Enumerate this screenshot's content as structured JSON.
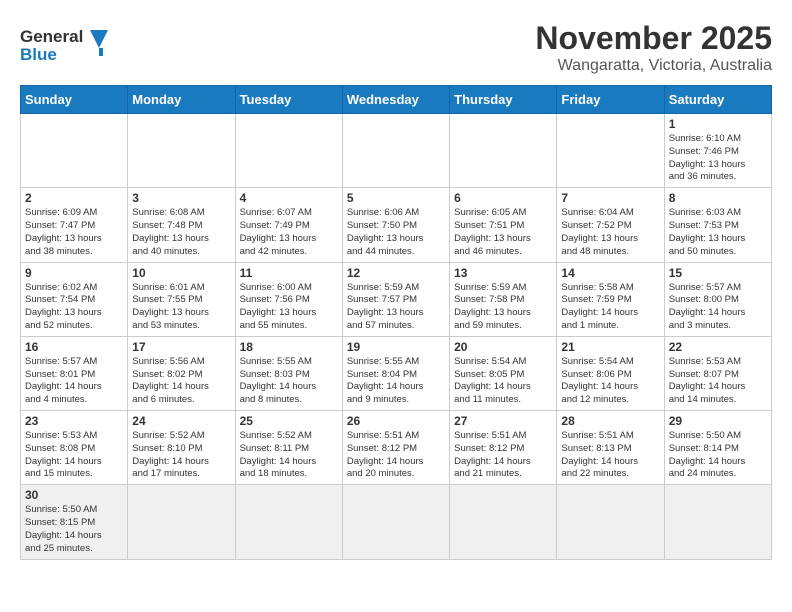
{
  "header": {
    "logo_general": "General",
    "logo_blue": "Blue",
    "month_title": "November 2025",
    "location": "Wangaratta, Victoria, Australia"
  },
  "days_of_week": [
    "Sunday",
    "Monday",
    "Tuesday",
    "Wednesday",
    "Thursday",
    "Friday",
    "Saturday"
  ],
  "weeks": [
    [
      {
        "day": "",
        "info": ""
      },
      {
        "day": "",
        "info": ""
      },
      {
        "day": "",
        "info": ""
      },
      {
        "day": "",
        "info": ""
      },
      {
        "day": "",
        "info": ""
      },
      {
        "day": "",
        "info": ""
      },
      {
        "day": "1",
        "info": "Sunrise: 6:10 AM\nSunset: 7:46 PM\nDaylight: 13 hours\nand 36 minutes."
      }
    ],
    [
      {
        "day": "2",
        "info": "Sunrise: 6:09 AM\nSunset: 7:47 PM\nDaylight: 13 hours\nand 38 minutes."
      },
      {
        "day": "3",
        "info": "Sunrise: 6:08 AM\nSunset: 7:48 PM\nDaylight: 13 hours\nand 40 minutes."
      },
      {
        "day": "4",
        "info": "Sunrise: 6:07 AM\nSunset: 7:49 PM\nDaylight: 13 hours\nand 42 minutes."
      },
      {
        "day": "5",
        "info": "Sunrise: 6:06 AM\nSunset: 7:50 PM\nDaylight: 13 hours\nand 44 minutes."
      },
      {
        "day": "6",
        "info": "Sunrise: 6:05 AM\nSunset: 7:51 PM\nDaylight: 13 hours\nand 46 minutes."
      },
      {
        "day": "7",
        "info": "Sunrise: 6:04 AM\nSunset: 7:52 PM\nDaylight: 13 hours\nand 48 minutes."
      },
      {
        "day": "8",
        "info": "Sunrise: 6:03 AM\nSunset: 7:53 PM\nDaylight: 13 hours\nand 50 minutes."
      }
    ],
    [
      {
        "day": "9",
        "info": "Sunrise: 6:02 AM\nSunset: 7:54 PM\nDaylight: 13 hours\nand 52 minutes."
      },
      {
        "day": "10",
        "info": "Sunrise: 6:01 AM\nSunset: 7:55 PM\nDaylight: 13 hours\nand 53 minutes."
      },
      {
        "day": "11",
        "info": "Sunrise: 6:00 AM\nSunset: 7:56 PM\nDaylight: 13 hours\nand 55 minutes."
      },
      {
        "day": "12",
        "info": "Sunrise: 5:59 AM\nSunset: 7:57 PM\nDaylight: 13 hours\nand 57 minutes."
      },
      {
        "day": "13",
        "info": "Sunrise: 5:59 AM\nSunset: 7:58 PM\nDaylight: 13 hours\nand 59 minutes."
      },
      {
        "day": "14",
        "info": "Sunrise: 5:58 AM\nSunset: 7:59 PM\nDaylight: 14 hours\nand 1 minute."
      },
      {
        "day": "15",
        "info": "Sunrise: 5:57 AM\nSunset: 8:00 PM\nDaylight: 14 hours\nand 3 minutes."
      }
    ],
    [
      {
        "day": "16",
        "info": "Sunrise: 5:57 AM\nSunset: 8:01 PM\nDaylight: 14 hours\nand 4 minutes."
      },
      {
        "day": "17",
        "info": "Sunrise: 5:56 AM\nSunset: 8:02 PM\nDaylight: 14 hours\nand 6 minutes."
      },
      {
        "day": "18",
        "info": "Sunrise: 5:55 AM\nSunset: 8:03 PM\nDaylight: 14 hours\nand 8 minutes."
      },
      {
        "day": "19",
        "info": "Sunrise: 5:55 AM\nSunset: 8:04 PM\nDaylight: 14 hours\nand 9 minutes."
      },
      {
        "day": "20",
        "info": "Sunrise: 5:54 AM\nSunset: 8:05 PM\nDaylight: 14 hours\nand 11 minutes."
      },
      {
        "day": "21",
        "info": "Sunrise: 5:54 AM\nSunset: 8:06 PM\nDaylight: 14 hours\nand 12 minutes."
      },
      {
        "day": "22",
        "info": "Sunrise: 5:53 AM\nSunset: 8:07 PM\nDaylight: 14 hours\nand 14 minutes."
      }
    ],
    [
      {
        "day": "23",
        "info": "Sunrise: 5:53 AM\nSunset: 8:08 PM\nDaylight: 14 hours\nand 15 minutes."
      },
      {
        "day": "24",
        "info": "Sunrise: 5:52 AM\nSunset: 8:10 PM\nDaylight: 14 hours\nand 17 minutes."
      },
      {
        "day": "25",
        "info": "Sunrise: 5:52 AM\nSunset: 8:11 PM\nDaylight: 14 hours\nand 18 minutes."
      },
      {
        "day": "26",
        "info": "Sunrise: 5:51 AM\nSunset: 8:12 PM\nDaylight: 14 hours\nand 20 minutes."
      },
      {
        "day": "27",
        "info": "Sunrise: 5:51 AM\nSunset: 8:12 PM\nDaylight: 14 hours\nand 21 minutes."
      },
      {
        "day": "28",
        "info": "Sunrise: 5:51 AM\nSunset: 8:13 PM\nDaylight: 14 hours\nand 22 minutes."
      },
      {
        "day": "29",
        "info": "Sunrise: 5:50 AM\nSunset: 8:14 PM\nDaylight: 14 hours\nand 24 minutes."
      }
    ],
    [
      {
        "day": "30",
        "info": "Sunrise: 5:50 AM\nSunset: 8:15 PM\nDaylight: 14 hours\nand 25 minutes."
      },
      {
        "day": "",
        "info": ""
      },
      {
        "day": "",
        "info": ""
      },
      {
        "day": "",
        "info": ""
      },
      {
        "day": "",
        "info": ""
      },
      {
        "day": "",
        "info": ""
      },
      {
        "day": "",
        "info": ""
      }
    ]
  ]
}
